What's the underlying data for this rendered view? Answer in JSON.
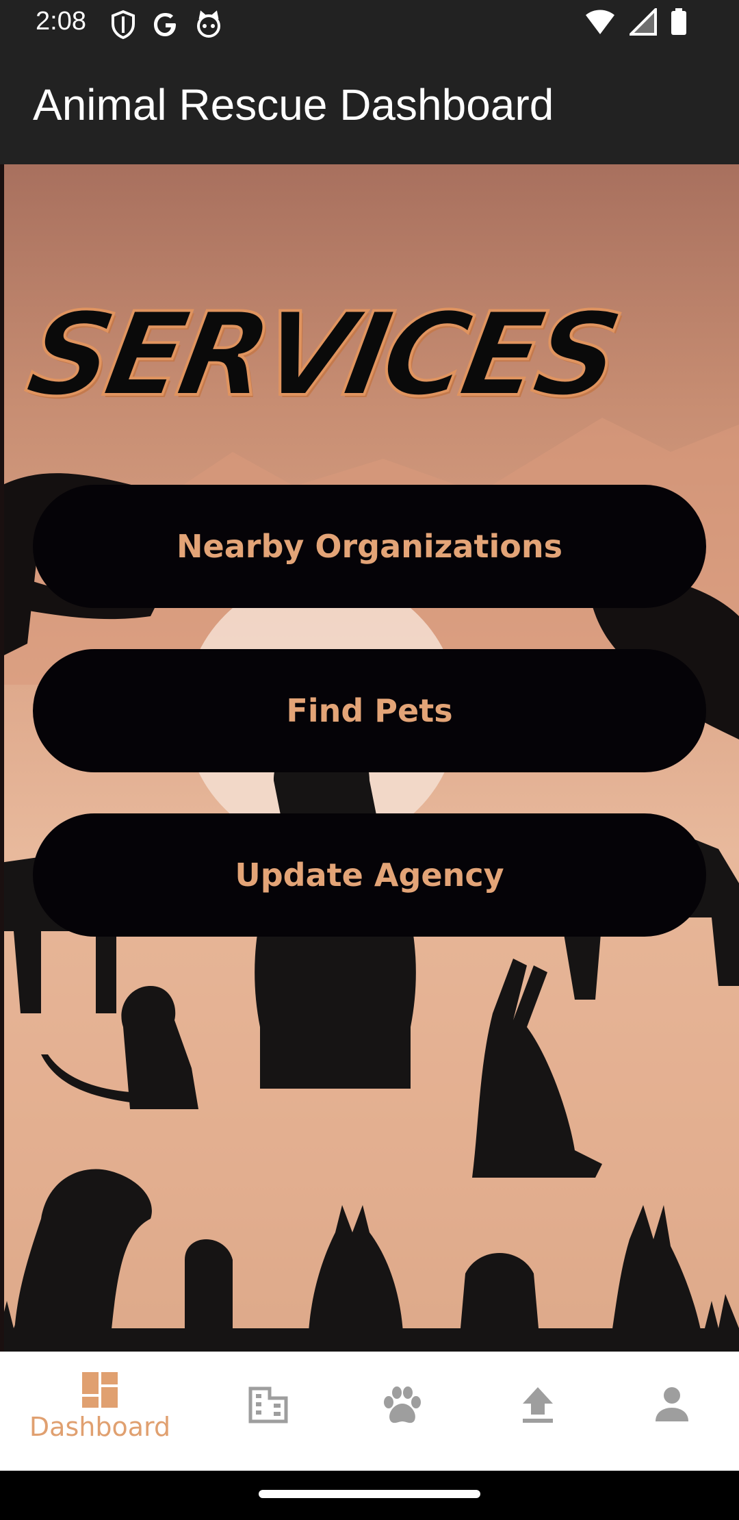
{
  "status_bar": {
    "time": "2:08",
    "left_icons": [
      "shield-icon",
      "google-icon",
      "cat-face-icon"
    ],
    "right_icons": [
      "wifi-icon",
      "signal-icon",
      "battery-icon"
    ]
  },
  "app_bar": {
    "title": "Animal Rescue Dashboard"
  },
  "content": {
    "heading": "SERVICES",
    "buttons": {
      "nearby": "Nearby Organizations",
      "find_pets": "Find Pets",
      "update_agency": "Update Agency"
    }
  },
  "bottom_nav": {
    "dashboard_label": "Dashboard",
    "items": [
      "dashboard-icon",
      "building-icon",
      "paw-icon",
      "upload-icon",
      "person-icon"
    ]
  },
  "colors": {
    "accent": "#e0a070",
    "button_bg": "#050307",
    "app_bar_bg": "#222222"
  }
}
